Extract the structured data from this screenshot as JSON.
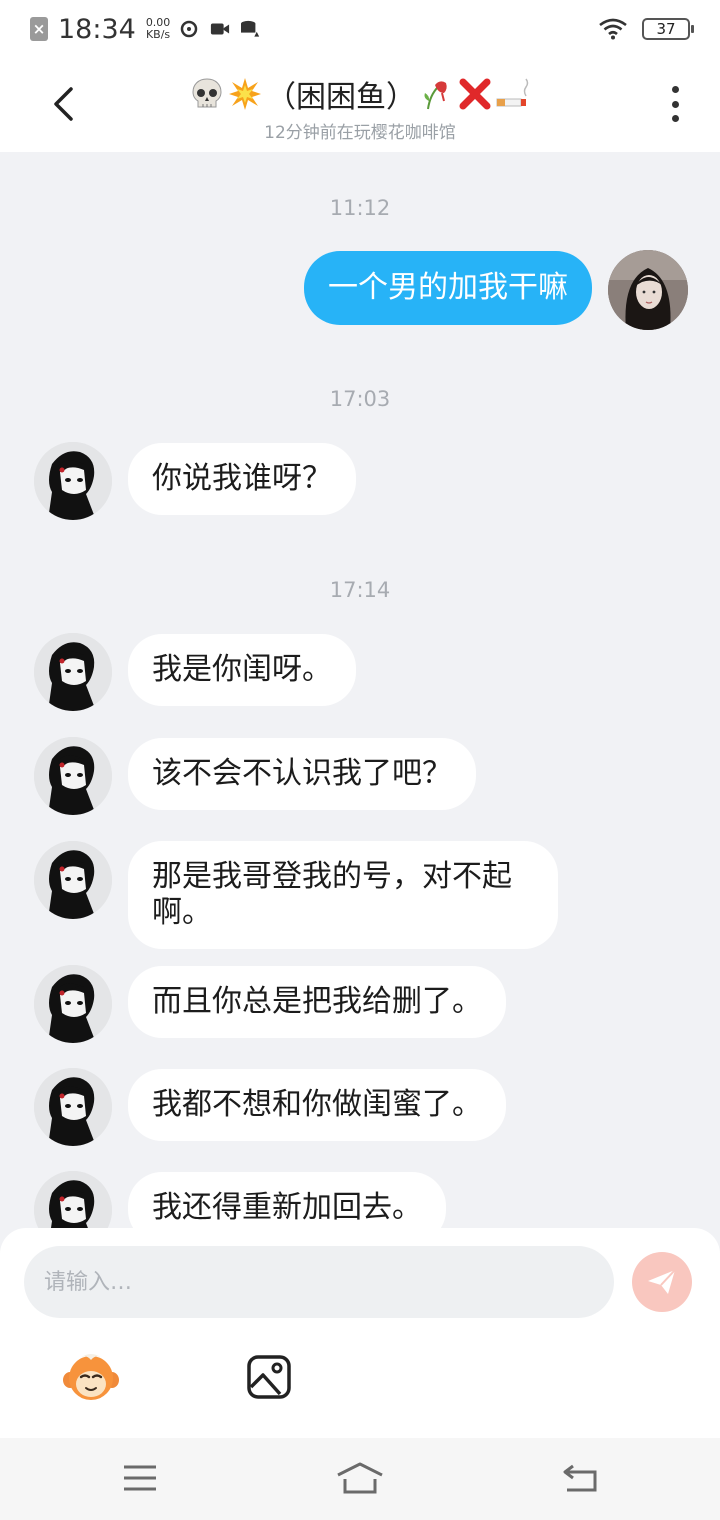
{
  "status_bar": {
    "time": "18:34",
    "speed_value": "0.00",
    "speed_unit": "KB/s",
    "battery": "37"
  },
  "header": {
    "title": "（困困鱼）",
    "subtitle": "12分钟前在玩樱花咖啡馆",
    "icons": [
      "back-icon",
      "skull-emoji",
      "explosion-emoji",
      "wilted-flower-emoji",
      "cross-mark-emoji",
      "cigarette-emoji",
      "more-icon"
    ]
  },
  "messages": [
    {
      "type": "time",
      "text": "11:12"
    },
    {
      "type": "sent",
      "text": "一个男的加我干嘛"
    },
    {
      "type": "time",
      "text": "17:03"
    },
    {
      "type": "received",
      "text": "你说我谁呀？"
    },
    {
      "type": "time",
      "text": "17:14"
    },
    {
      "type": "received",
      "text": "我是你闺呀。"
    },
    {
      "type": "received",
      "text": "该不会不认识我了吧？"
    },
    {
      "type": "received",
      "text": "那是我哥登我的号，对不起啊。"
    },
    {
      "type": "received",
      "text": "而且你总是把我给删了。"
    },
    {
      "type": "received",
      "text": "我都不想和你做闺蜜了。"
    },
    {
      "type": "received",
      "text": "我还得重新加回去。"
    }
  ],
  "input": {
    "placeholder": "请输入…",
    "value": ""
  },
  "colors": {
    "sent_bubble": "#27b3f7",
    "received_bubble": "#ffffff",
    "send_button": "#f9c7bf",
    "background": "#f1f2f5"
  }
}
